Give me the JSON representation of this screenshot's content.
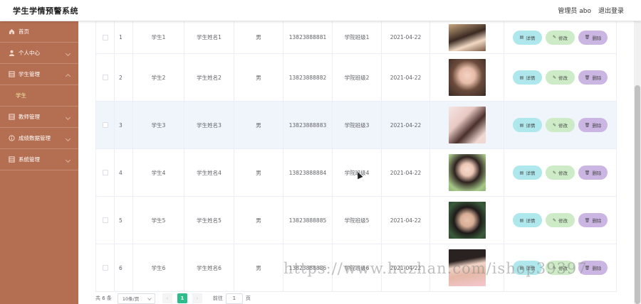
{
  "header": {
    "title": "学生学情预警系统",
    "admin_label": "管理员 abo",
    "logout_label": "退出登录"
  },
  "sidebar": {
    "items": [
      {
        "label": "首页",
        "icon": "home-icon"
      },
      {
        "label": "个人中心",
        "icon": "user-icon"
      },
      {
        "label": "学生管理",
        "icon": "grid-icon"
      },
      {
        "label": "教师管理",
        "icon": "grid-icon"
      },
      {
        "label": "成绩数据管理",
        "icon": "info-icon"
      },
      {
        "label": "系统管理",
        "icon": "grid-icon"
      }
    ],
    "active_sub": "学生"
  },
  "table": {
    "rows": [
      {
        "index": "1",
        "student_no": "学生1",
        "name": "学生姓名1",
        "gender": "男",
        "phone": "13823888881",
        "class": "学院班级1",
        "date": "2021-04-22"
      },
      {
        "index": "2",
        "student_no": "学生2",
        "name": "学生姓名2",
        "gender": "男",
        "phone": "13823888882",
        "class": "学院班级2",
        "date": "2021-04-22"
      },
      {
        "index": "3",
        "student_no": "学生3",
        "name": "学生姓名3",
        "gender": "男",
        "phone": "13823888883",
        "class": "学院班级3",
        "date": "2021-04-22"
      },
      {
        "index": "4",
        "student_no": "学生4",
        "name": "学生姓名4",
        "gender": "男",
        "phone": "13823888884",
        "class": "学院班级4",
        "date": "2021-04-22"
      },
      {
        "index": "5",
        "student_no": "学生5",
        "name": "学生姓名5",
        "gender": "男",
        "phone": "13823888885",
        "class": "学院班级5",
        "date": "2021-04-22"
      },
      {
        "index": "6",
        "student_no": "学生6",
        "name": "学生姓名6",
        "gender": "男",
        "phone": "13823888886",
        "class": "学院班级6",
        "date": "2021-04-22"
      }
    ],
    "actions": {
      "detail": "详情",
      "edit": "修改",
      "delete": "删除"
    }
  },
  "pagination": {
    "total": "共 6 条",
    "page_size": "10条/页",
    "prev": "‹",
    "current": "1",
    "next": "›",
    "goto_label": "前往",
    "goto_value": "1",
    "page_unit": "页"
  },
  "watermark": "https://www.huzhan.com/ishop39397",
  "colors": {
    "sidebar_bg": "#b46e51",
    "active_sub_text": "#f6f0a8",
    "detail_btn": "#aee8ec",
    "edit_btn": "#cdebc6",
    "delete_btn": "#cbb6e3",
    "pager_active": "#2bbd8a"
  }
}
